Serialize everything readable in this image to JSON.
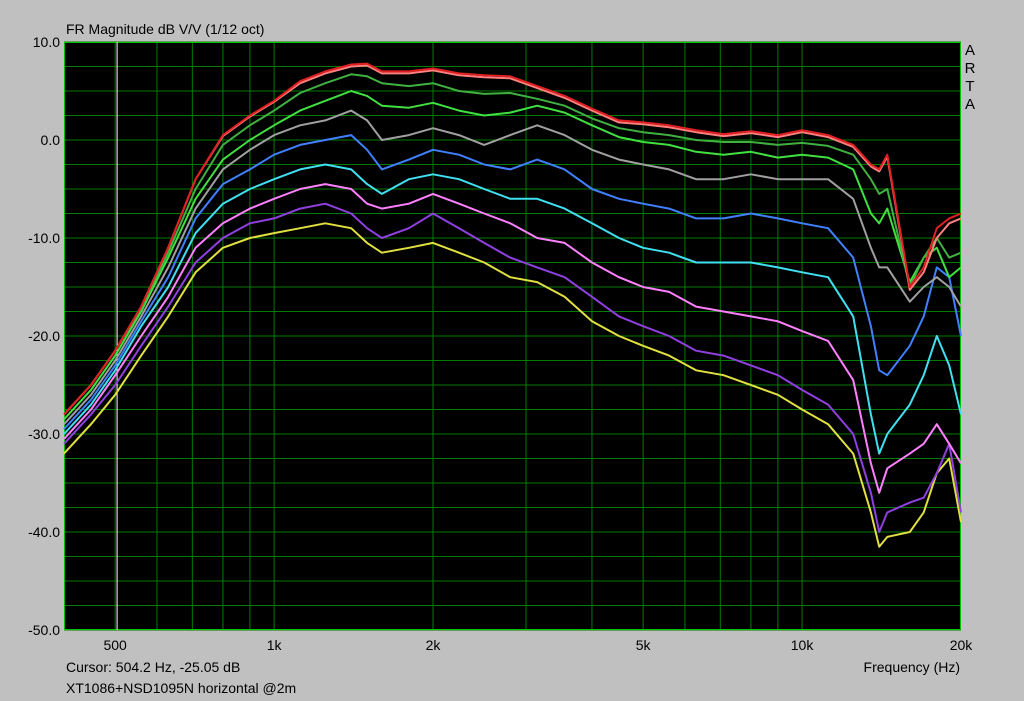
{
  "header": {
    "title": "FR Magnitude dB V/V (1/12 oct)",
    "brand_letters": [
      "A",
      "R",
      "T",
      "A"
    ]
  },
  "footer": {
    "cursor": "Cursor: 504.2 Hz, -25.05 dB",
    "caption": "XT1086+NSD1095N horizontal @2m",
    "xlabel": "Frequency (Hz)"
  },
  "colors": {
    "background": "#c0c0c0",
    "plot_bg": "#000000",
    "grid": "#007d00",
    "cursor_line": "#ffffff",
    "plot_border": "#00c000"
  },
  "chart_data": {
    "type": "line",
    "title": "FR Magnitude dB V/V (1/12 oct)",
    "xlabel": "Frequency (Hz)",
    "ylabel": "",
    "xscale": "log",
    "xlim": [
      400,
      20000
    ],
    "ylim": [
      -50,
      10
    ],
    "grid": true,
    "legend": "none",
    "cursor_x": 504.2,
    "x_ticks": [
      {
        "value": 500,
        "label": "500"
      },
      {
        "value": 1000,
        "label": "1k"
      },
      {
        "value": 2000,
        "label": "2k"
      },
      {
        "value": 5000,
        "label": "5k"
      },
      {
        "value": 10000,
        "label": "10k"
      },
      {
        "value": 20000,
        "label": "20k"
      }
    ],
    "y_ticks": [
      {
        "value": 10,
        "label": "10.0"
      },
      {
        "value": 0,
        "label": "0.0"
      },
      {
        "value": -10,
        "label": "-10.0"
      },
      {
        "value": -20,
        "label": "-20.0"
      },
      {
        "value": -30,
        "label": "-30.0"
      },
      {
        "value": -40,
        "label": "-40.0"
      },
      {
        "value": -50,
        "label": "-50.0"
      }
    ],
    "series": [
      {
        "color": "#e02020",
        "x": [
          400,
          450,
          500,
          560,
          630,
          710,
          800,
          900,
          1000,
          1120,
          1250,
          1400,
          1500,
          1600,
          1800,
          2000,
          2240,
          2500,
          2800,
          3150,
          3550,
          4000,
          4500,
          5000,
          5600,
          6300,
          7100,
          8000,
          9000,
          10000,
          11200,
          12500,
          13500,
          14000,
          14500,
          16000,
          17000,
          18000,
          19000,
          20000
        ],
        "y": [
          -28,
          -25,
          -21.5,
          -17,
          -11,
          -4,
          0.5,
          2.5,
          4,
          6,
          7,
          7.7,
          7.8,
          7,
          7,
          7.3,
          6.8,
          6.6,
          6.5,
          5.5,
          4.5,
          3.2,
          2,
          1.8,
          1.5,
          1,
          0.6,
          0.9,
          0.5,
          1,
          0.5,
          -0.5,
          -2.5,
          -3,
          -1.5,
          -15,
          -13,
          -9,
          -8,
          -7.5
        ]
      },
      {
        "color": "#ff8080",
        "x": [
          400,
          450,
          500,
          560,
          630,
          710,
          800,
          900,
          1000,
          1120,
          1250,
          1400,
          1500,
          1600,
          1800,
          2000,
          2240,
          2500,
          2800,
          3150,
          3550,
          4000,
          4500,
          5000,
          5600,
          6300,
          7100,
          8000,
          9000,
          10000,
          11200,
          12500,
          13500,
          14000,
          14500,
          16000,
          17000,
          18000,
          19000,
          20000
        ],
        "y": [
          -28,
          -25,
          -21.5,
          -17,
          -11,
          -4,
          0.4,
          2.4,
          3.9,
          5.8,
          6.8,
          7.5,
          7.6,
          6.8,
          6.8,
          7.1,
          6.6,
          6.4,
          6.3,
          5.3,
          4.3,
          3,
          1.8,
          1.6,
          1.3,
          0.8,
          0.4,
          0.7,
          0.3,
          0.8,
          0.3,
          -0.7,
          -2.7,
          -3.2,
          -1.7,
          -15.3,
          -13.5,
          -10,
          -8.5,
          -8
        ]
      },
      {
        "color": "#40b040",
        "x": [
          400,
          450,
          500,
          560,
          630,
          710,
          800,
          900,
          1000,
          1120,
          1250,
          1400,
          1500,
          1600,
          1800,
          2000,
          2240,
          2500,
          2800,
          3150,
          3550,
          4000,
          4500,
          5000,
          5600,
          6300,
          7100,
          8000,
          9000,
          10000,
          11200,
          12500,
          13500,
          14000,
          14500,
          16000,
          17000,
          18000,
          19000,
          20000
        ],
        "y": [
          -28,
          -25,
          -21.5,
          -17.2,
          -11.5,
          -5,
          -0.5,
          1.5,
          3,
          4.8,
          5.8,
          6.7,
          6.5,
          5.8,
          5.5,
          5.8,
          5,
          4.7,
          4.8,
          4.2,
          3.5,
          2.2,
          1.2,
          0.8,
          0.5,
          0,
          -0.2,
          -0.2,
          -0.5,
          -0.3,
          -0.6,
          -1.5,
          -4,
          -5.5,
          -5,
          -15,
          -12,
          -10,
          -12,
          -11.5
        ]
      },
      {
        "color": "#40e040",
        "x": [
          400,
          450,
          500,
          560,
          630,
          710,
          800,
          900,
          1000,
          1120,
          1250,
          1400,
          1500,
          1600,
          1800,
          2000,
          2240,
          2500,
          2800,
          3150,
          3550,
          4000,
          4500,
          5000,
          5600,
          6300,
          7100,
          8000,
          9000,
          10000,
          11200,
          12500,
          13500,
          14000,
          14500,
          16000,
          17000,
          18000,
          19000,
          20000
        ],
        "y": [
          -28.5,
          -25.5,
          -22,
          -17.5,
          -12,
          -6,
          -2,
          0,
          1.5,
          3,
          4,
          5,
          4.5,
          3.5,
          3.3,
          3.8,
          3,
          2.5,
          2.8,
          3.5,
          2.8,
          1.5,
          0.3,
          -0.2,
          -0.5,
          -1.2,
          -1.5,
          -1.2,
          -1.8,
          -1.5,
          -1.8,
          -3,
          -7.5,
          -8.5,
          -7,
          -14.5,
          -12,
          -11,
          -14,
          -13
        ]
      },
      {
        "color": "#a0a0a0",
        "x": [
          400,
          450,
          500,
          560,
          630,
          710,
          800,
          900,
          1000,
          1120,
          1250,
          1400,
          1500,
          1600,
          1800,
          2000,
          2240,
          2500,
          2800,
          3150,
          3550,
          4000,
          4500,
          5000,
          5600,
          6300,
          7100,
          8000,
          9000,
          10000,
          11200,
          12500,
          13500,
          14000,
          14500,
          16000,
          17000,
          18000,
          19000,
          20000
        ],
        "y": [
          -29,
          -26,
          -22.5,
          -18,
          -13,
          -7,
          -3,
          -1,
          0.5,
          1.5,
          2,
          3,
          2,
          0,
          0.5,
          1.2,
          0.5,
          -0.5,
          0.5,
          1.5,
          0.5,
          -1,
          -2,
          -2.5,
          -3,
          -4,
          -4,
          -3.5,
          -4,
          -4,
          -4,
          -6,
          -11,
          -13,
          -13,
          -16.5,
          -15,
          -14,
          -15,
          -17
        ]
      },
      {
        "color": "#4080ff",
        "x": [
          400,
          450,
          500,
          560,
          630,
          710,
          800,
          900,
          1000,
          1120,
          1250,
          1400,
          1500,
          1600,
          1800,
          2000,
          2240,
          2500,
          2800,
          3150,
          3550,
          4000,
          4500,
          5000,
          5600,
          6300,
          7100,
          8000,
          9000,
          10000,
          11200,
          12500,
          13500,
          14000,
          14500,
          16000,
          17000,
          18000,
          19000,
          20000
        ],
        "y": [
          -29.5,
          -26.5,
          -23,
          -18.5,
          -14,
          -8,
          -4.5,
          -3,
          -1.5,
          -0.5,
          0,
          0.5,
          -1,
          -3,
          -2,
          -1,
          -1.5,
          -2.5,
          -3,
          -2,
          -3,
          -5,
          -6,
          -6.5,
          -7,
          -8,
          -8,
          -7.5,
          -8,
          -8.5,
          -9,
          -12,
          -19,
          -23.5,
          -24,
          -21,
          -18,
          -13,
          -14,
          -20
        ]
      },
      {
        "color": "#40e0f0",
        "x": [
          400,
          450,
          500,
          560,
          630,
          710,
          800,
          900,
          1000,
          1120,
          1250,
          1400,
          1500,
          1600,
          1800,
          2000,
          2240,
          2500,
          2800,
          3150,
          3550,
          4000,
          4500,
          5000,
          5600,
          6300,
          7100,
          8000,
          9000,
          10000,
          11200,
          12500,
          13500,
          14000,
          14500,
          16000,
          17000,
          18000,
          19000,
          20000
        ],
        "y": [
          -30,
          -27,
          -23.5,
          -19,
          -15,
          -9.5,
          -6.5,
          -5,
          -4,
          -3,
          -2.5,
          -3,
          -4.5,
          -5.5,
          -4,
          -3.5,
          -4,
          -5,
          -6,
          -6,
          -7,
          -8.5,
          -10,
          -11,
          -11.5,
          -12.5,
          -12.5,
          -12.5,
          -13,
          -13.5,
          -14,
          -18,
          -28,
          -32,
          -30,
          -27,
          -24,
          -20,
          -23,
          -28
        ]
      },
      {
        "color": "#ff80ff",
        "x": [
          400,
          450,
          500,
          560,
          630,
          710,
          800,
          900,
          1000,
          1120,
          1250,
          1400,
          1500,
          1600,
          1800,
          2000,
          2240,
          2500,
          2800,
          3150,
          3550,
          4000,
          4500,
          5000,
          5600,
          6300,
          7100,
          8000,
          9000,
          10000,
          11200,
          12500,
          13500,
          14000,
          14500,
          16000,
          17000,
          18000,
          19000,
          20000
        ],
        "y": [
          -30.5,
          -27.5,
          -24,
          -20,
          -16,
          -11,
          -8.5,
          -7,
          -6,
          -5,
          -4.5,
          -5,
          -6.5,
          -7,
          -6.5,
          -5.5,
          -6.5,
          -7.5,
          -8.5,
          -10,
          -10.5,
          -12.5,
          -14,
          -15,
          -15.5,
          -17,
          -17.5,
          -18,
          -18.5,
          -19.5,
          -20.5,
          -24.5,
          -33,
          -36,
          -33.5,
          -32,
          -31,
          -29,
          -31,
          -33
        ]
      },
      {
        "color": "#9040e0",
        "x": [
          400,
          450,
          500,
          560,
          630,
          710,
          800,
          900,
          1000,
          1120,
          1250,
          1400,
          1500,
          1600,
          1800,
          2000,
          2240,
          2500,
          2800,
          3150,
          3550,
          4000,
          4500,
          5000,
          5600,
          6300,
          7100,
          8000,
          9000,
          10000,
          11200,
          12500,
          13500,
          14000,
          14500,
          16000,
          17000,
          18000,
          19000,
          20000
        ],
        "y": [
          -31,
          -28,
          -25,
          -21,
          -17,
          -12.5,
          -10,
          -8.5,
          -8,
          -7,
          -6.5,
          -7.5,
          -9,
          -10,
          -9,
          -7.5,
          -9,
          -10.5,
          -12,
          -13,
          -14,
          -16,
          -18,
          -19,
          -20,
          -21.5,
          -22,
          -23,
          -24,
          -25.5,
          -27,
          -30,
          -36,
          -40,
          -38,
          -37,
          -36.5,
          -34,
          -31,
          -38
        ]
      },
      {
        "color": "#e0e040",
        "x": [
          400,
          450,
          500,
          560,
          630,
          710,
          800,
          900,
          1000,
          1120,
          1250,
          1400,
          1500,
          1600,
          1800,
          2000,
          2240,
          2500,
          2800,
          3150,
          3550,
          4000,
          4500,
          5000,
          5600,
          6300,
          7100,
          8000,
          9000,
          10000,
          11200,
          12500,
          13500,
          14000,
          14500,
          16000,
          17000,
          18000,
          19000,
          20000
        ],
        "y": [
          -32,
          -29,
          -26,
          -22,
          -18,
          -13.5,
          -11,
          -10,
          -9.5,
          -9,
          -8.5,
          -9,
          -10.5,
          -11.5,
          -11,
          -10.5,
          -11.5,
          -12.5,
          -14,
          -14.5,
          -16,
          -18.5,
          -20,
          -21,
          -22,
          -23.5,
          -24,
          -25,
          -26,
          -27.5,
          -29,
          -32,
          -38,
          -41.5,
          -40.5,
          -40,
          -38,
          -34,
          -32.5,
          -39
        ]
      }
    ]
  }
}
